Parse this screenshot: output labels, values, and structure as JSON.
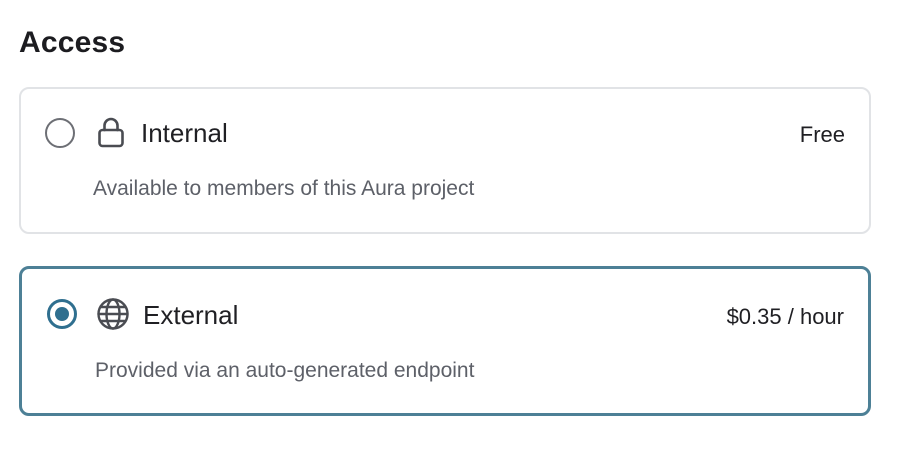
{
  "section": {
    "title": "Access"
  },
  "options": [
    {
      "label": "Internal",
      "price": "Free",
      "description": "Available to members of this Aura project",
      "icon": "lock-icon",
      "selected": false
    },
    {
      "label": "External",
      "price": "$0.35 / hour",
      "description": "Provided via an auto-generated endpoint",
      "icon": "globe-icon",
      "selected": true
    }
  ],
  "colors": {
    "selected_accent": "#2f6f8f",
    "selected_border": "#4d8096",
    "unselected_border": "#e1e3e6",
    "description_text": "#5d6068"
  }
}
